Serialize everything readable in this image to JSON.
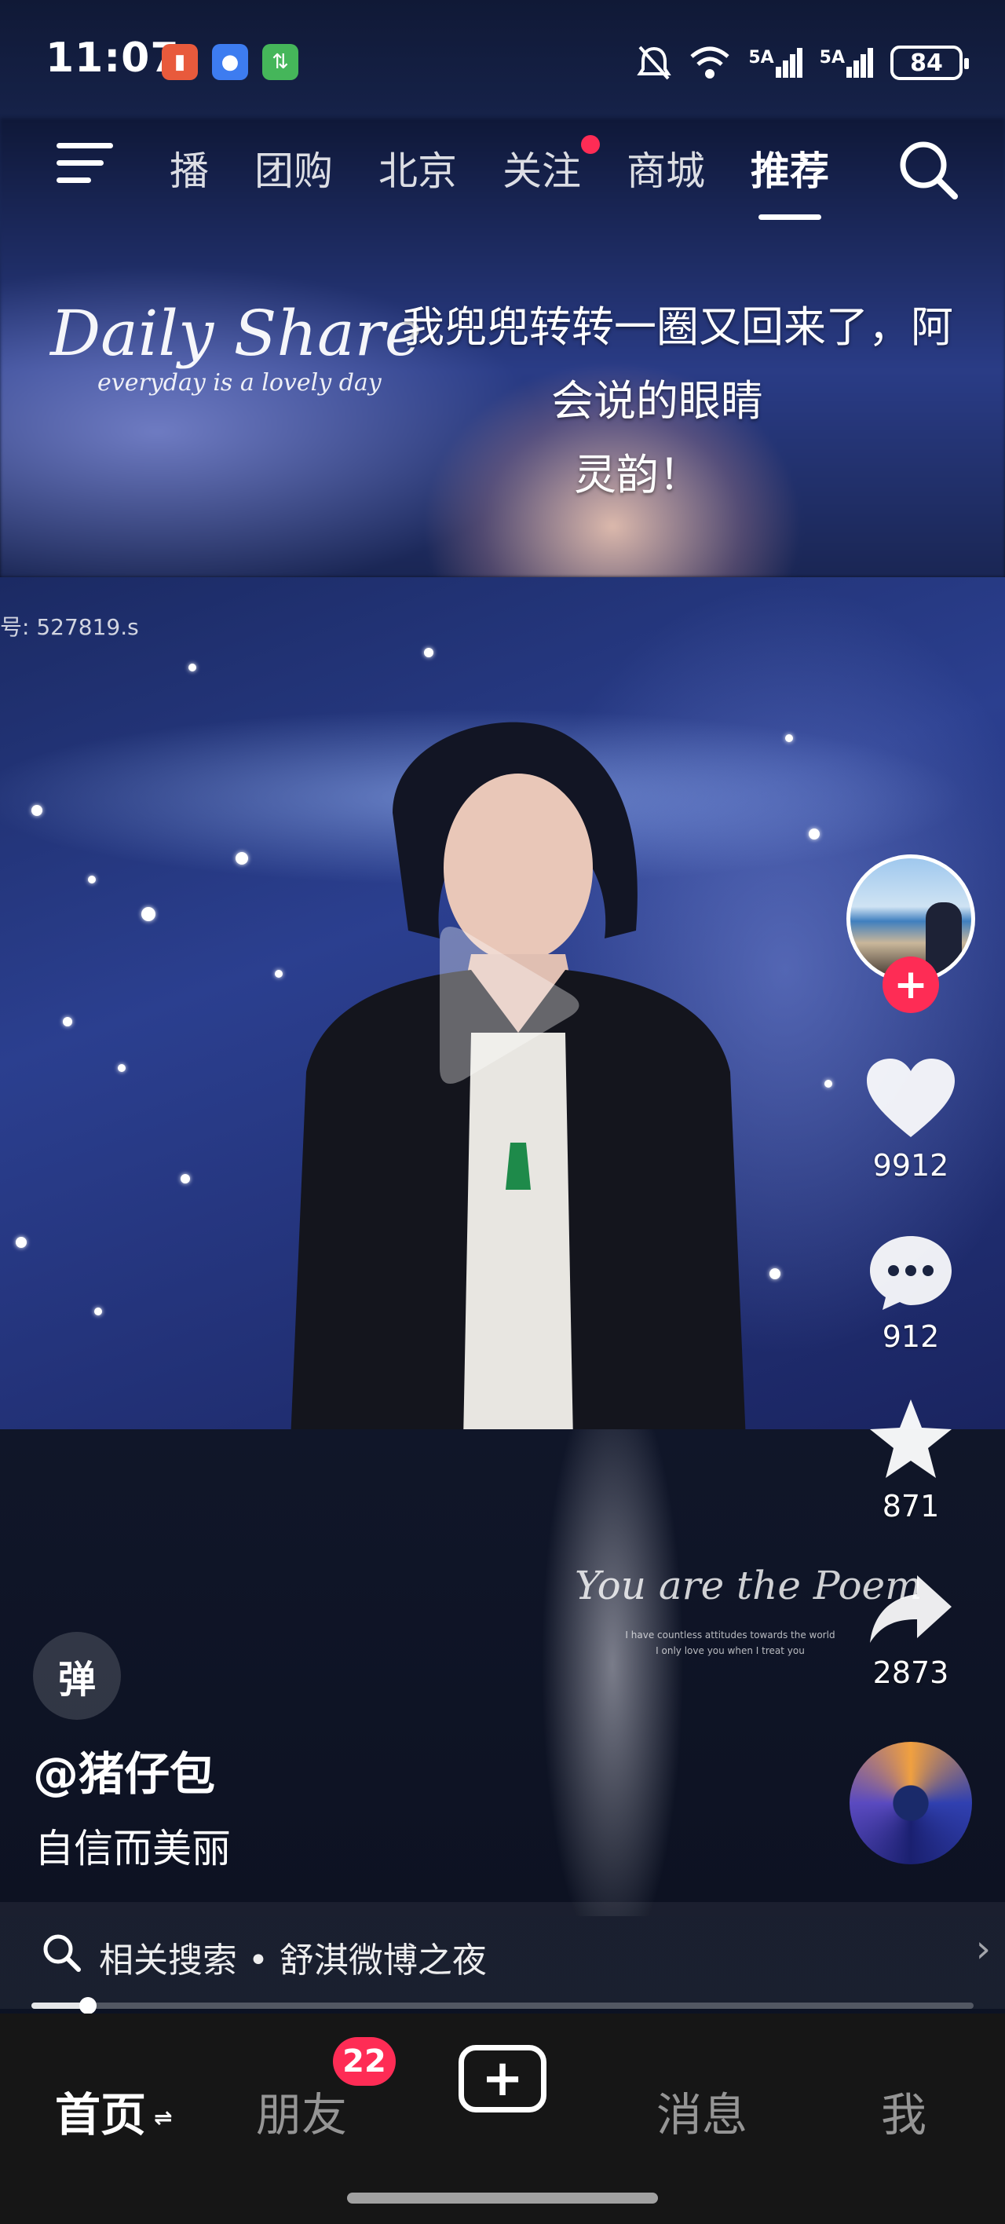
{
  "status_bar": {
    "time": "11:07",
    "network_1": "5A",
    "network_2": "5A",
    "battery": "84"
  },
  "top_tabs": {
    "items": [
      {
        "label": "播",
        "active": false
      },
      {
        "label": "团购",
        "active": false
      },
      {
        "label": "北京",
        "active": false
      },
      {
        "label": "关注",
        "active": false,
        "dot": true
      },
      {
        "label": "商城",
        "active": false
      },
      {
        "label": "推荐",
        "active": true
      }
    ]
  },
  "video": {
    "overlay_title": "Daily Share",
    "overlay_subtitle": "everyday is a lovely day",
    "caption_line1": "我兜兜转转一圈又回来了，阿",
    "caption_line2": "会说的眼睛",
    "caption_line3": "灵韵！",
    "watermark": "号: 527819.s",
    "poem_title": "You are the Poem",
    "poem_line1": "I have countless attitudes towards the world",
    "poem_line2": "I only love you when I treat you"
  },
  "sidebar": {
    "likes": "9912",
    "comments": "912",
    "favorites": "871",
    "shares": "2873",
    "follow_label": "+"
  },
  "post": {
    "danmu_label": "弹",
    "author": "@猪仔包",
    "description": "自信而美丽"
  },
  "related_search": {
    "text": "相关搜索 • 舒淇微博之夜",
    "arrow": "›"
  },
  "progress": {
    "fraction": 0.06
  },
  "bottom_nav": {
    "home": "首页",
    "home_swap": "⇌",
    "friends": "朋友",
    "friends_badge": "22",
    "create": "+",
    "messages": "消息",
    "me": "我"
  },
  "colors": {
    "accent": "#fe2c55",
    "bottom_bar": "#161616"
  }
}
